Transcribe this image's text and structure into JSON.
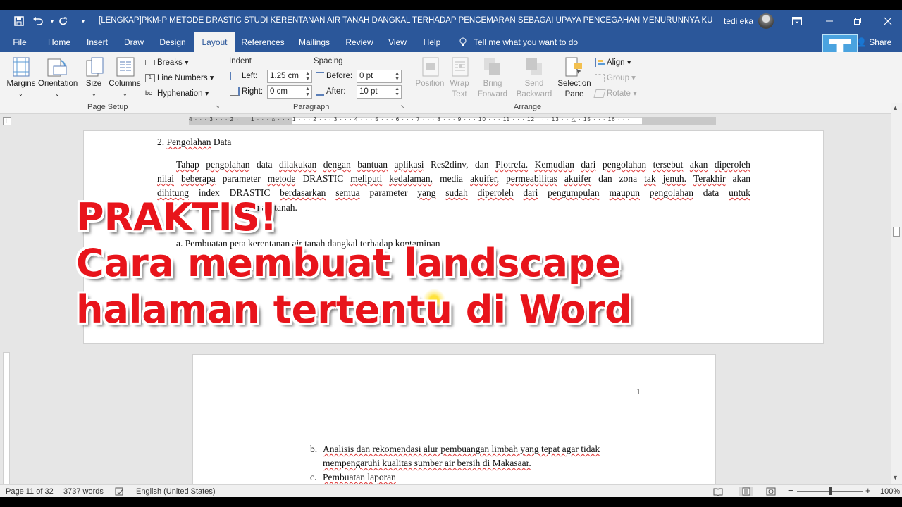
{
  "window": {
    "title": "[LENGKAP]PKM-P METODE DRASTIC STUDI KERENTANAN AIR TANAH DANGKAL TERHADAP PENCEMARAN SEBAGAI UPAYA PENCEGAHAN MENURUNNYA KUALITAS AIR B...",
    "user": "tedi eka",
    "accent": "#2b579a"
  },
  "tabs": [
    "File",
    "Home",
    "Insert",
    "Draw",
    "Design",
    "Layout",
    "References",
    "Mailings",
    "Review",
    "View",
    "Help"
  ],
  "tell_me": "Tell me what you want to do",
  "share": "Share",
  "ribbon": {
    "page_setup": {
      "margins": "Margins",
      "orientation": "Orientation",
      "size": "Size",
      "columns": "Columns",
      "breaks": "Breaks",
      "line_numbers": "Line Numbers",
      "hyphenation": "Hyphenation",
      "label": "Page Setup"
    },
    "paragraph": {
      "indent": "Indent",
      "spacing": "Spacing",
      "left_label": "Left:",
      "left_value": "1.25 cm",
      "right_label": "Right:",
      "right_value": "0 cm",
      "before_label": "Before:",
      "before_value": "0 pt",
      "after_label": "After:",
      "after_value": "10 pt",
      "label": "Paragraph"
    },
    "arrange": {
      "position": "Position",
      "wrap_1": "Wrap",
      "wrap_2": "Text",
      "bring_1": "Bring",
      "bring_2": "Forward",
      "send_1": "Send",
      "send_2": "Backward",
      "sel_1": "Selection",
      "sel_2": "Pane",
      "align": "Align",
      "group": "Group",
      "rotate": "Rotate",
      "label": "Arrange"
    }
  },
  "ruler": {
    "tab_selector": "L",
    "numbers": "4 · · · 3 · · · 2 · · · 1 · · · ⌂ · · · 1 · · · 2 · · · 3 · · · 4 · · · 5 · · · 6 · · · 7 · · · 8 · · · 9 · · · 10 · · · 11 · · · 12 · · · 13 · · △ · 15 · · · 16 · · ·"
  },
  "document": {
    "heading_num": "2. ",
    "heading_word": "Pengolahan",
    "heading_rest": " Data",
    "para_line1": [
      "Tahap",
      "pengolahan",
      "data",
      "dilakukan",
      "dengan",
      "bantuan",
      "aplikasi",
      "Res2dinv,",
      "dan",
      "Plotrefa.",
      "Kemudian",
      "dari",
      "pengolahan",
      "tersebut",
      "akan",
      "diperoleh"
    ],
    "para_line2": [
      "nilai",
      "beberapa",
      "parameter",
      "metode",
      "DRASTIC",
      "meliputi",
      "kedalaman,",
      "media",
      "akuifer,",
      "permeabilitas",
      "akuifer",
      "dan",
      "zona",
      "tak",
      "jenuh.",
      "Terakhir",
      "akan"
    ],
    "para_line3": [
      "dihitung",
      "index",
      "DRASTIC",
      "berdasarkan",
      "semua",
      "parameter",
      "yang",
      "sudah",
      "diperoleh",
      "dari",
      "pengumpulan",
      "maupun",
      "pengolahan",
      "data",
      "untuk"
    ],
    "para_line4": "aran air tanah.",
    "list_a": "a.  Pembuatan peta kerentanan air tanah dangkal terhadap kontaminan",
    "page_number": "1",
    "list_b_marker": "b.",
    "list_b_1": "Analisis dan rekomendasi alur pembuangan limbah yang tepat agar tidak",
    "list_b_2": "mempengaruhi kualitas sumber air bersih di Makasaar.",
    "list_c_marker": "c.",
    "list_c": "Pembuatan laporan"
  },
  "overlay": {
    "line1": "PRAKTIS!",
    "line2": "Cara membuat landscape",
    "line3": "halaman tertentu di Word"
  },
  "status": {
    "page": "Page 11 of 32",
    "words": "3737 words",
    "language": "English (United States)",
    "zoom": "100%"
  }
}
